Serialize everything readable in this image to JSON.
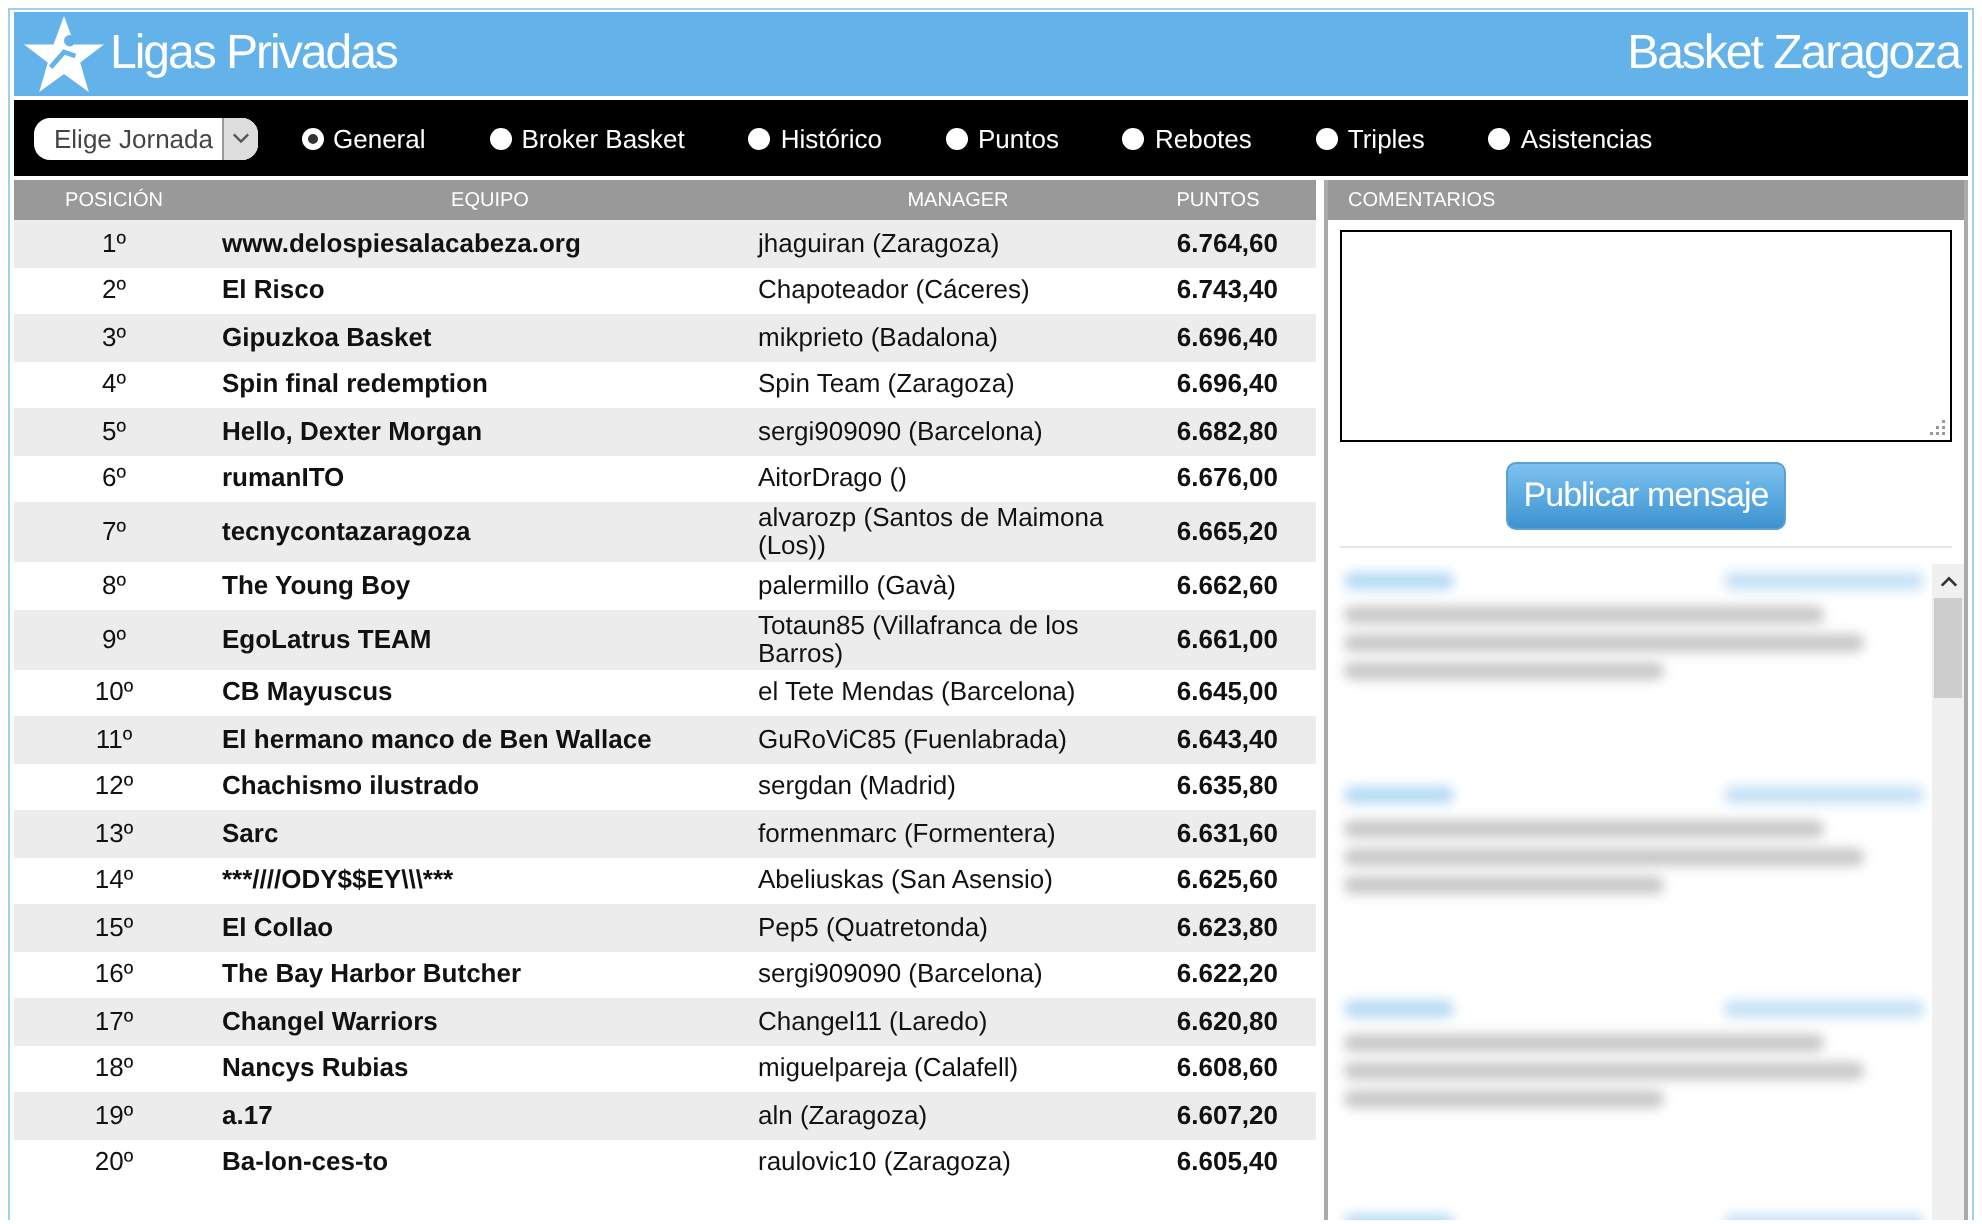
{
  "header": {
    "logo_text": "Ligas Privadas",
    "league": "Basket Zaragoza"
  },
  "filter": {
    "select": "Elige Jornada",
    "options": [
      {
        "label": "General",
        "selected": true
      },
      {
        "label": "Broker Basket",
        "selected": false
      },
      {
        "label": "Histórico",
        "selected": false
      },
      {
        "label": "Puntos",
        "selected": false
      },
      {
        "label": "Rebotes",
        "selected": false
      },
      {
        "label": "Triples",
        "selected": false
      },
      {
        "label": "Asistencias",
        "selected": false
      }
    ]
  },
  "table": {
    "columns": [
      "POSICIÓN",
      "EQUIPO",
      "MANAGER",
      "PUNTOS"
    ],
    "rows": [
      {
        "pos": "1º",
        "team": "www.delospiesalacabeza.org",
        "manager": "jhaguiran (Zaragoza)",
        "points": "6.764,60"
      },
      {
        "pos": "2º",
        "team": "El Risco",
        "manager": "Chapoteador (Cáceres)",
        "points": "6.743,40"
      },
      {
        "pos": "3º",
        "team": "Gipuzkoa Basket",
        "manager": "mikprieto (Badalona)",
        "points": "6.696,40"
      },
      {
        "pos": "4º",
        "team": "Spin final redemption",
        "manager": "Spin Team (Zaragoza)",
        "points": "6.696,40"
      },
      {
        "pos": "5º",
        "team": "Hello, Dexter Morgan",
        "manager": "sergi909090 (Barcelona)",
        "points": "6.682,80"
      },
      {
        "pos": "6º",
        "team": "rumanITO",
        "manager": "AitorDrago ()",
        "points": "6.676,00"
      },
      {
        "pos": "7º",
        "team": "tecnycontazaragoza",
        "manager": "alvarozp (Santos de Maimona (Los))",
        "points": "6.665,20"
      },
      {
        "pos": "8º",
        "team": "The Young Boy",
        "manager": "palermillo (Gavà)",
        "points": "6.662,60"
      },
      {
        "pos": "9º",
        "team": "EgoLatrus TEAM",
        "manager": "Totaun85 (Villafranca de los Barros)",
        "points": "6.661,00"
      },
      {
        "pos": "10º",
        "team": "CB Mayuscus",
        "manager": "el Tete Mendas (Barcelona)",
        "points": "6.645,00"
      },
      {
        "pos": "11º",
        "team": "El hermano manco de Ben Wallace",
        "manager": "GuRoViC85 (Fuenlabrada)",
        "points": "6.643,40"
      },
      {
        "pos": "12º",
        "team": "Chachismo ilustrado",
        "manager": "sergdan (Madrid)",
        "points": "6.635,80"
      },
      {
        "pos": "13º",
        "team": "Sarc",
        "manager": "formenmarc (Formentera)",
        "points": "6.631,60"
      },
      {
        "pos": "14º",
        "team": "***////ODY$$EY\\\\\\***",
        "manager": "Abeliuskas (San Asensio)",
        "points": "6.625,60"
      },
      {
        "pos": "15º",
        "team": "El Collao",
        "manager": "Pep5 (Quatretonda)",
        "points": "6.623,80"
      },
      {
        "pos": "16º",
        "team": "The Bay Harbor Butcher",
        "manager": "sergi909090 (Barcelona)",
        "points": "6.622,20"
      },
      {
        "pos": "17º",
        "team": "Changel Warriors",
        "manager": "Changel11 (Laredo)",
        "points": "6.620,80"
      },
      {
        "pos": "18º",
        "team": "Nancys Rubias",
        "manager": "miguelpareja (Calafell)",
        "points": "6.608,60"
      },
      {
        "pos": "19º",
        "team": "a.17",
        "manager": "aln (Zaragoza)",
        "points": "6.607,20"
      },
      {
        "pos": "20º",
        "team": "Ba-lon-ces-to",
        "manager": "raulovic10 (Zaragoza)",
        "points": "6.605,40"
      }
    ]
  },
  "comments": {
    "heading": "COMENTARIOS",
    "button": "Publicar mensaje"
  }
}
